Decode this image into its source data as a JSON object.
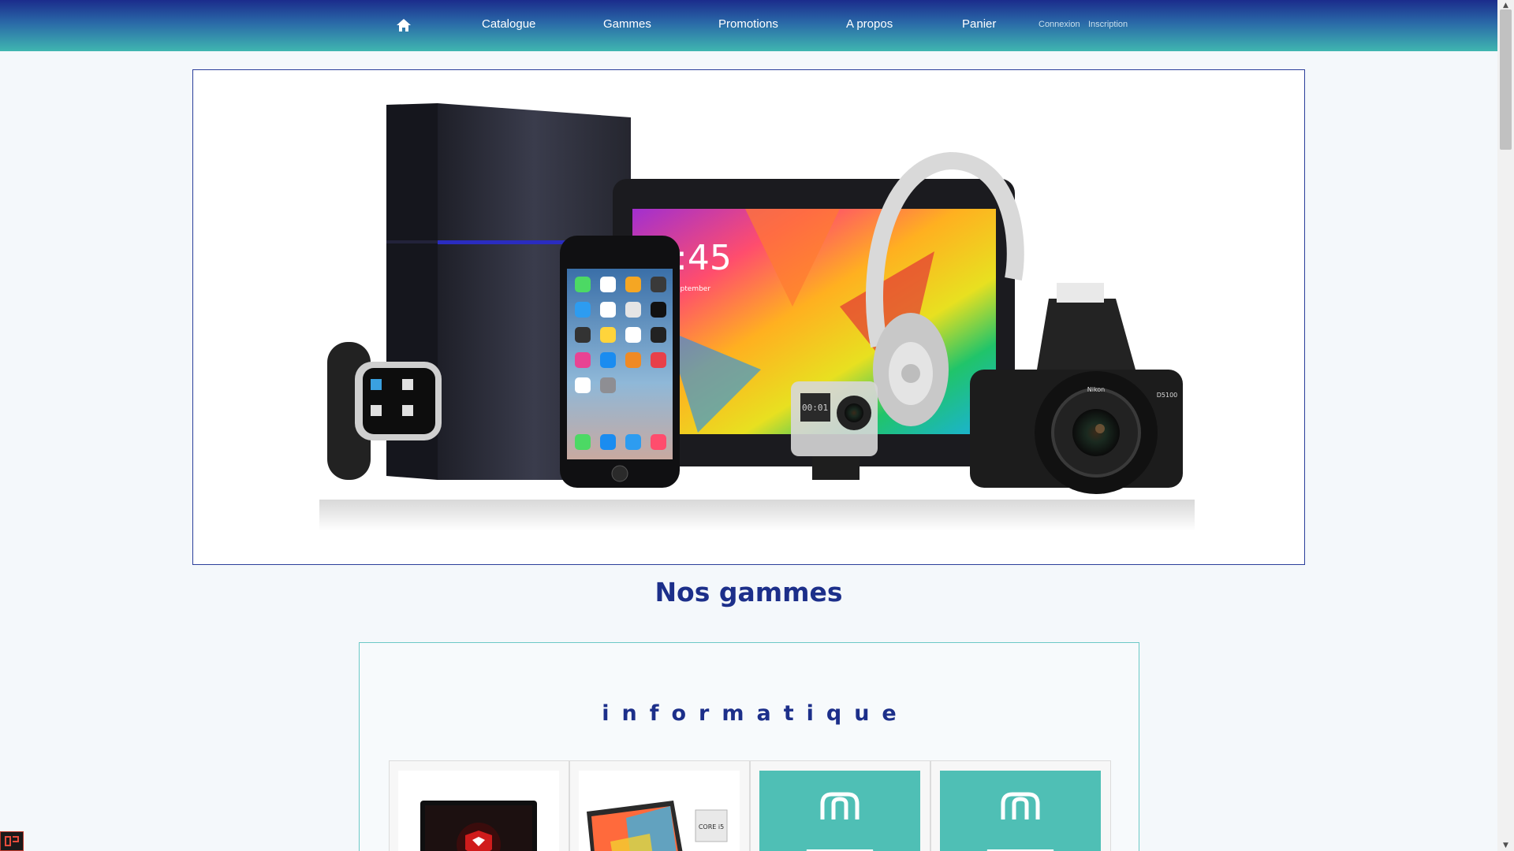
{
  "nav": {
    "home_icon": "home-icon",
    "links": [
      "Catalogue",
      "Gammes",
      "Promotions",
      "A propos",
      "Panier"
    ],
    "login": "Connexion",
    "signup": "Inscription"
  },
  "hero": {
    "image": "electronics-banner",
    "clock_text": ":45",
    "date_text": "eptember",
    "camera_brand": "Nikon",
    "camera_model": "D5100",
    "gopro_display": "00:01"
  },
  "section_title": "Nos gammes",
  "category": {
    "title": "informatique",
    "cards": [
      {
        "kind": "msi-laptop"
      },
      {
        "kind": "colorful-laptop",
        "sticker": "CORE i5"
      },
      {
        "kind": "placeholder-bag",
        "icon": "shopping-bag-icon"
      },
      {
        "kind": "placeholder-bag",
        "icon": "shopping-bag-icon"
      }
    ]
  },
  "colors": {
    "nav_top": "#1b2c8c",
    "nav_bottom": "#3fb6b0",
    "title": "#1c2f8a",
    "teal": "#4fbfb5"
  }
}
